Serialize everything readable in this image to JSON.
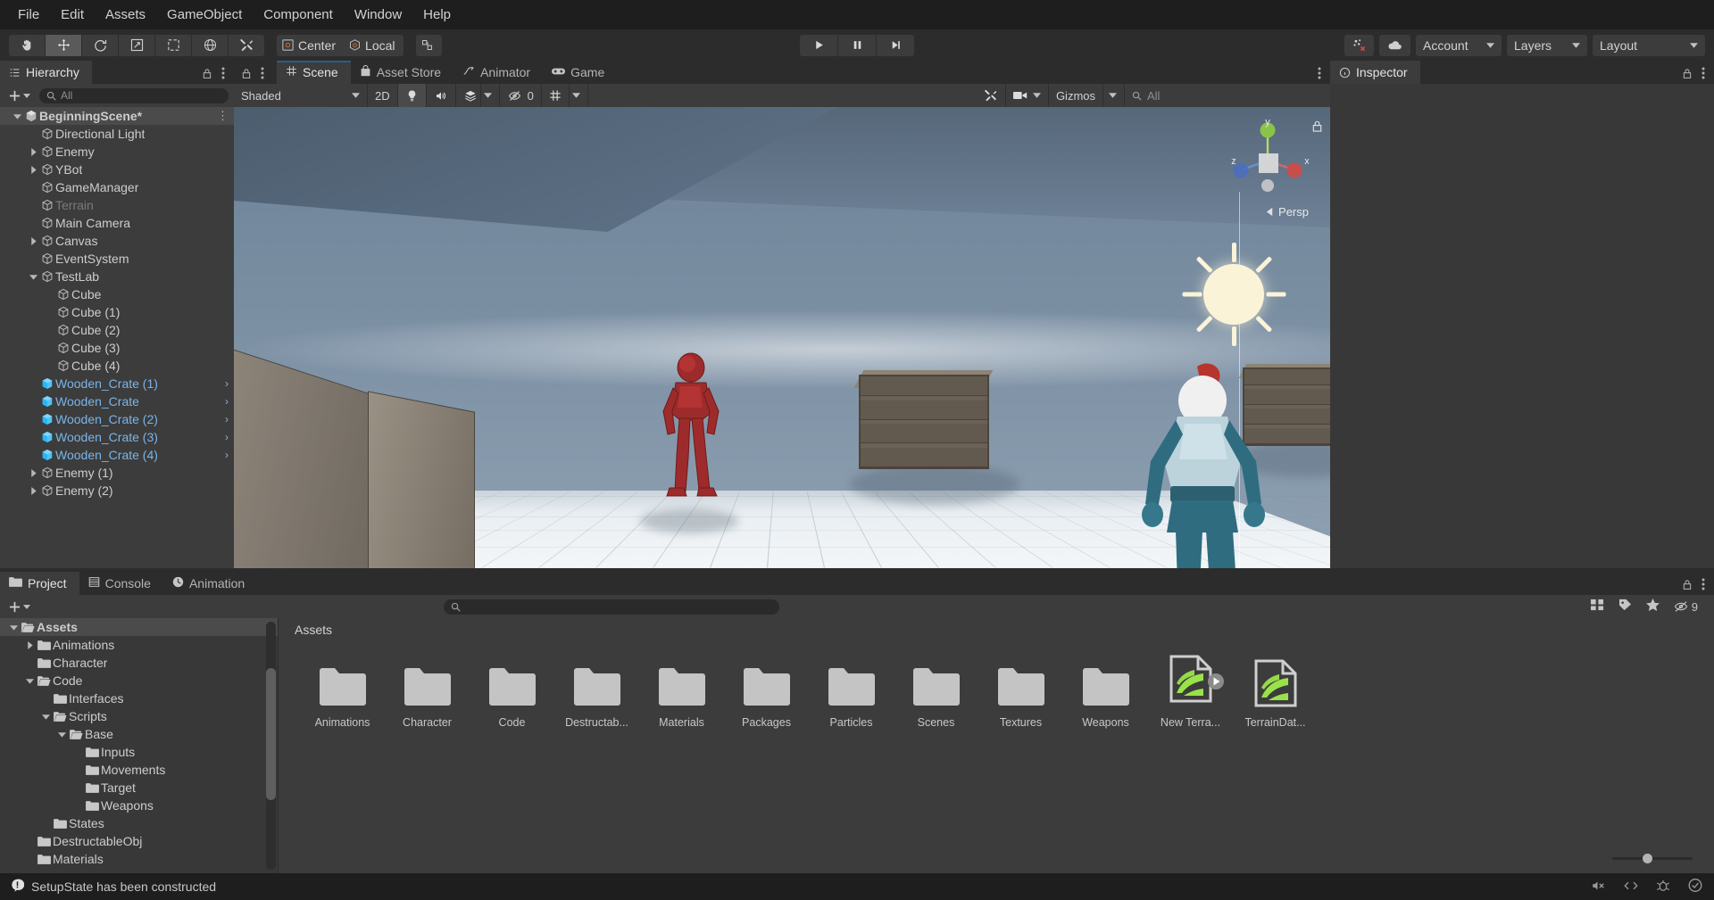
{
  "menu": {
    "items": [
      "File",
      "Edit",
      "Assets",
      "GameObject",
      "Component",
      "Window",
      "Help"
    ]
  },
  "toolbar": {
    "tools": [
      {
        "name": "hand-tool",
        "label": "Hand",
        "active": false
      },
      {
        "name": "move-tool",
        "label": "Move",
        "active": true
      },
      {
        "name": "rotate-tool",
        "label": "Rotate",
        "active": false
      },
      {
        "name": "scale-tool",
        "label": "Scale",
        "active": false
      },
      {
        "name": "rect-tool",
        "label": "Rect",
        "active": false
      },
      {
        "name": "transform-tool",
        "label": "Transform",
        "active": false
      },
      {
        "name": "custom-tool",
        "label": "Custom Editor Tool",
        "active": false
      }
    ],
    "pivot_label": "Center",
    "rotation_label": "Local",
    "play_label": "Play",
    "pause_label": "Pause",
    "step_label": "Step",
    "collab_label": "Collab",
    "cloud_label": "Cloud",
    "account_label": "Account",
    "layers_label": "Layers",
    "layout_label": "Layout"
  },
  "hierarchy": {
    "tab_label": "Hierarchy",
    "search_placeholder": "All",
    "create_label": "+",
    "items": [
      {
        "label": "BeginningScene*",
        "depth": 0,
        "icon": "scene-icon",
        "arrow": "down",
        "selected": true,
        "style": "scene"
      },
      {
        "label": "Directional Light",
        "depth": 1,
        "icon": "gameobject-icon",
        "arrow": "none",
        "style": "normal"
      },
      {
        "label": "Enemy",
        "depth": 1,
        "icon": "gameobject-icon",
        "arrow": "right",
        "style": "normal"
      },
      {
        "label": "YBot",
        "depth": 1,
        "icon": "gameobject-icon",
        "arrow": "right",
        "style": "normal"
      },
      {
        "label": "GameManager",
        "depth": 1,
        "icon": "gameobject-icon",
        "arrow": "none",
        "style": "normal"
      },
      {
        "label": "Terrain",
        "depth": 1,
        "icon": "gameobject-icon",
        "arrow": "none",
        "style": "disabled"
      },
      {
        "label": "Main Camera",
        "depth": 1,
        "icon": "gameobject-icon",
        "arrow": "none",
        "style": "normal"
      },
      {
        "label": "Canvas",
        "depth": 1,
        "icon": "gameobject-icon",
        "arrow": "right",
        "style": "normal"
      },
      {
        "label": "EventSystem",
        "depth": 1,
        "icon": "gameobject-icon",
        "arrow": "none",
        "style": "normal"
      },
      {
        "label": "TestLab",
        "depth": 1,
        "icon": "gameobject-icon",
        "arrow": "down",
        "style": "normal"
      },
      {
        "label": "Cube",
        "depth": 2,
        "icon": "gameobject-icon",
        "arrow": "none",
        "style": "normal"
      },
      {
        "label": "Cube (1)",
        "depth": 2,
        "icon": "gameobject-icon",
        "arrow": "none",
        "style": "normal"
      },
      {
        "label": "Cube (2)",
        "depth": 2,
        "icon": "gameobject-icon",
        "arrow": "none",
        "style": "normal"
      },
      {
        "label": "Cube (3)",
        "depth": 2,
        "icon": "gameobject-icon",
        "arrow": "none",
        "style": "normal"
      },
      {
        "label": "Cube (4)",
        "depth": 2,
        "icon": "gameobject-icon",
        "arrow": "none",
        "style": "normal"
      },
      {
        "label": "Wooden_Crate (1)",
        "depth": 1,
        "icon": "prefab-icon",
        "arrow": "none",
        "style": "prefab",
        "has_chevron": true
      },
      {
        "label": "Wooden_Crate",
        "depth": 1,
        "icon": "prefab-icon",
        "arrow": "none",
        "style": "prefab",
        "has_chevron": true
      },
      {
        "label": "Wooden_Crate (2)",
        "depth": 1,
        "icon": "prefab-icon",
        "arrow": "none",
        "style": "prefab",
        "has_chevron": true
      },
      {
        "label": "Wooden_Crate (3)",
        "depth": 1,
        "icon": "prefab-icon",
        "arrow": "none",
        "style": "prefab",
        "has_chevron": true
      },
      {
        "label": "Wooden_Crate (4)",
        "depth": 1,
        "icon": "prefab-icon",
        "arrow": "none",
        "style": "prefab",
        "has_chevron": true
      },
      {
        "label": "Enemy (1)",
        "depth": 1,
        "icon": "gameobject-icon",
        "arrow": "right",
        "style": "normal"
      },
      {
        "label": "Enemy (2)",
        "depth": 1,
        "icon": "gameobject-icon",
        "arrow": "right",
        "style": "normal"
      }
    ]
  },
  "scene_panel": {
    "tabs": [
      {
        "label": "Scene",
        "icon": "scene-grid-icon",
        "active": true
      },
      {
        "label": "Asset Store",
        "icon": "store-icon",
        "active": false
      },
      {
        "label": "Animator",
        "icon": "animator-icon",
        "active": false
      },
      {
        "label": "Game",
        "icon": "game-controller-icon",
        "active": false
      }
    ],
    "draw_mode": "Shaded",
    "mode_2d": "2D",
    "hidden_count": "0",
    "gizmos_label": "Gizmos",
    "search_placeholder": "All",
    "orientation_label": "Persp",
    "axis_x": "x",
    "axis_y": "y",
    "axis_z": "z"
  },
  "inspector": {
    "tab_label": "Inspector"
  },
  "project_panel": {
    "tabs": [
      {
        "label": "Project",
        "icon": "folder-icon",
        "active": true
      },
      {
        "label": "Console",
        "icon": "console-icon",
        "active": false
      },
      {
        "label": "Animation",
        "icon": "clock-icon",
        "active": false
      }
    ],
    "search_placeholder": "",
    "favorites_count": "9",
    "breadcrumb": "Assets",
    "tree": [
      {
        "label": "Assets",
        "depth": 0,
        "arrow": "down",
        "open": true,
        "selected": true
      },
      {
        "label": "Animations",
        "depth": 1,
        "arrow": "right",
        "open": false,
        "selected": false
      },
      {
        "label": "Character",
        "depth": 1,
        "arrow": "none",
        "open": false,
        "selected": false
      },
      {
        "label": "Code",
        "depth": 1,
        "arrow": "down",
        "open": true,
        "selected": false
      },
      {
        "label": "Interfaces",
        "depth": 2,
        "arrow": "none",
        "open": false,
        "selected": false
      },
      {
        "label": "Scripts",
        "depth": 2,
        "arrow": "down",
        "open": true,
        "selected": false
      },
      {
        "label": "Base",
        "depth": 3,
        "arrow": "down",
        "open": true,
        "selected": false
      },
      {
        "label": "Inputs",
        "depth": 4,
        "arrow": "none",
        "open": false,
        "selected": false
      },
      {
        "label": "Movements",
        "depth": 4,
        "arrow": "none",
        "open": false,
        "selected": false
      },
      {
        "label": "Target",
        "depth": 4,
        "arrow": "none",
        "open": false,
        "selected": false
      },
      {
        "label": "Weapons",
        "depth": 4,
        "arrow": "none",
        "open": false,
        "selected": false
      },
      {
        "label": "States",
        "depth": 2,
        "arrow": "none",
        "open": false,
        "selected": false
      },
      {
        "label": "DestructableObj",
        "depth": 1,
        "arrow": "none",
        "open": false,
        "selected": false
      },
      {
        "label": "Materials",
        "depth": 1,
        "arrow": "none",
        "open": false,
        "selected": false
      }
    ],
    "assets": [
      {
        "label": "Animations",
        "type": "folder"
      },
      {
        "label": "Character",
        "type": "folder"
      },
      {
        "label": "Code",
        "type": "folder"
      },
      {
        "label": "Destructab...",
        "type": "folder"
      },
      {
        "label": "Materials",
        "type": "folder"
      },
      {
        "label": "Packages",
        "type": "folder"
      },
      {
        "label": "Particles",
        "type": "folder"
      },
      {
        "label": "Scenes",
        "type": "folder"
      },
      {
        "label": "Textures",
        "type": "folder"
      },
      {
        "label": "Weapons",
        "type": "folder"
      },
      {
        "label": "New Terra...",
        "type": "terrain-asset"
      },
      {
        "label": "TerrainDat...",
        "type": "terrain-data"
      }
    ]
  },
  "status_bar": {
    "message": "SetupState has been constructed"
  },
  "colors": {
    "accent_blue": "#2c5d87",
    "prefab_blue": "#7ab4e8",
    "terrain_green": "#9ae24a",
    "panel_bg": "#383838",
    "toolbar_bg": "#2c2c2c",
    "tree_bg": "#3c3c3c"
  }
}
